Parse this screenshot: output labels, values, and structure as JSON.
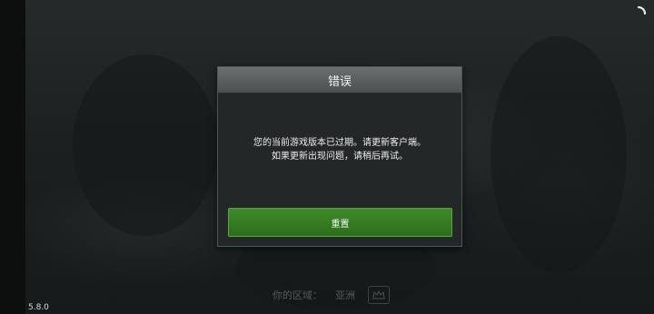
{
  "dialog": {
    "title": "错误",
    "message_line_1": "您的当前游戏版本已过期。请更新客户端。",
    "message_line_2": "如果更新出现问题，请稍后再试。",
    "button_label": "重置"
  },
  "region": {
    "label": "你的区域：",
    "value": "亚洲"
  },
  "version": "5.8.0",
  "colors": {
    "button_green": "#3a7f26",
    "dialog_bg": "#242727",
    "header_gray": "#5b6061"
  },
  "icons": {
    "loading": "loading-spinner-icon",
    "region": "crown-icon"
  }
}
